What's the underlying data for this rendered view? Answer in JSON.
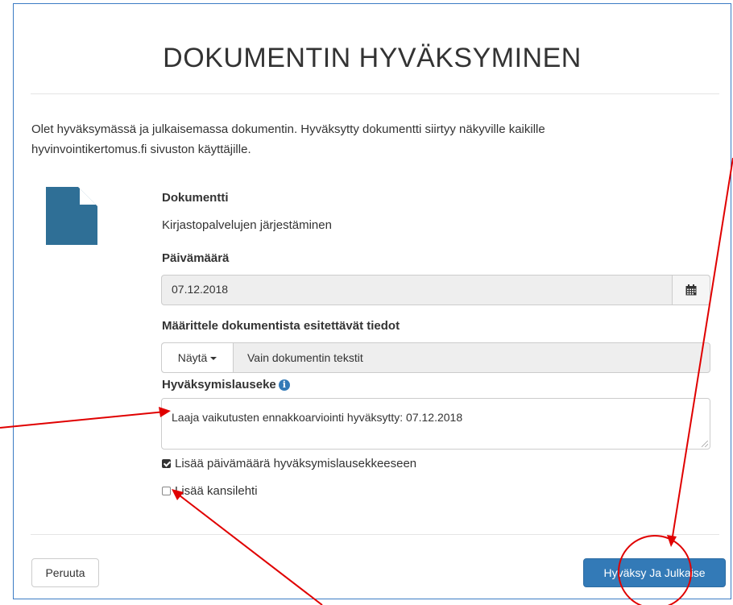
{
  "dialog": {
    "title": "DOKUMENTIN HYVÄKSYMINEN",
    "intro_line1": "Olet hyväksymässä ja julkaisemassa dokumentin. Hyväksytty dokumentti siirtyy näkyville kaikille",
    "intro_line2": "hyvinvointikertomus.fi sivuston käyttäjille."
  },
  "document": {
    "icon": "file-icon",
    "label": "Dokumentti",
    "name": "Kirjastopalvelujen järjestäminen"
  },
  "date": {
    "label": "Päivämäärä",
    "value": "07.12.2018",
    "icon": "calendar-icon"
  },
  "display": {
    "label": "Määrittele dokumentista esitettävät tiedot",
    "dropdown_label": "Näytä",
    "selected": "Vain dokumentin tekstit"
  },
  "approval": {
    "label": "Hyväksymislauseke",
    "info_icon": "info-icon",
    "value": "Laaja vaikutusten ennakkoarviointi hyväksytty: 07.12.2018"
  },
  "options": {
    "add_date_label": "Lisää päivämäärä hyväksymislausekkeeseen",
    "add_date_checked": true,
    "add_cover_label": "Lisää kansilehti",
    "add_cover_checked": false
  },
  "footer": {
    "cancel_label": "Peruuta",
    "approve_label": "Hyväksy Ja Julkaise"
  },
  "colors": {
    "primary": "#337ab7",
    "doc_icon": "#2f6f96",
    "annotation": "#e00000"
  }
}
